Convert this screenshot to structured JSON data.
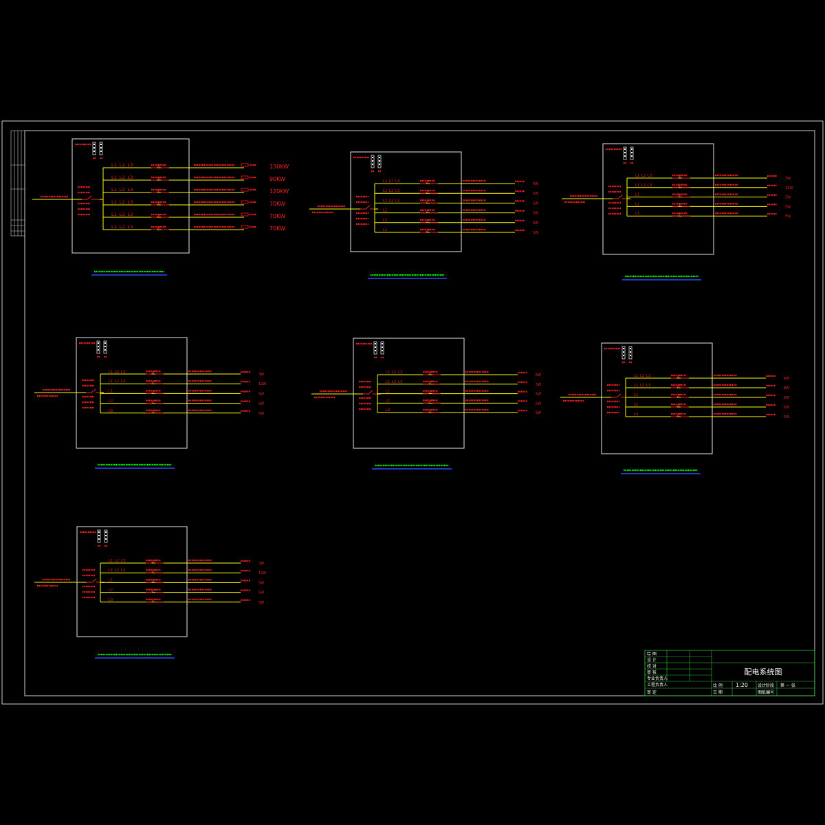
{
  "colors": {
    "background": "#000000",
    "frame": "#d0d0d0",
    "box": "#e8e8e8",
    "red": "#ff2020",
    "yellow": "#ffff00",
    "green": "#00ff00",
    "blue": "#2a4cff",
    "tb_green": "#33cc33"
  },
  "panel_top": {
    "loads": [
      "130KW",
      "90KW",
      "120KW",
      "70KW",
      "70KW",
      "70KW"
    ],
    "phases": [
      "L1 L2 L3",
      "L1 L2 L3",
      "L1 L2 L3",
      "L1 L2 L3",
      "L1 L2 L3",
      "L1 L2 L3"
    ]
  },
  "panel_c1": {
    "phases": [
      "L1 L2 L3",
      "L1 L2 L3",
      "L1 L2 L3",
      "L2",
      "L3",
      "L1"
    ],
    "kw": [
      "5W",
      "5W",
      "5W",
      "5W",
      "5W",
      "5W"
    ]
  },
  "panel_r1": {
    "phases": [
      "L1 L2 L3",
      "L1 L2 L3",
      "L1",
      "L2",
      "L3"
    ],
    "kw": [
      "3W",
      "15W",
      "5W",
      "5W",
      "5W"
    ]
  },
  "panel_l2": {
    "phases": [
      "L1 L2 L3",
      "L1 L2 L3",
      "L1",
      "L2",
      "L3"
    ],
    "kw": [
      "3W",
      "10W",
      "5W",
      "5W",
      "5W"
    ]
  },
  "panel_c2": {
    "phases": [
      "L1 L2 L3",
      "L1 L2 L3",
      "L1",
      "L2",
      "L3"
    ],
    "kw": [
      "6W",
      "5W",
      "5W",
      "5W",
      "5W"
    ]
  },
  "panel_r2": {
    "phases": [
      "L1 L2 L3",
      "L1 L2 L3",
      "L1",
      "L2",
      "L3"
    ],
    "kw": [
      "6W",
      "8W",
      "5W",
      "5W",
      "5W"
    ]
  },
  "panel_l3": {
    "phases": [
      "L1 L2 L3",
      "L1 L2 L3",
      "L1",
      "L2",
      "L3"
    ],
    "kw": [
      "3W",
      "10W",
      "5W",
      "5W",
      "5W"
    ]
  },
  "title_block": {
    "drawing_title": "配电系统图",
    "scale_label": "比 例",
    "scale_value": "1:20",
    "date_label": "日 期",
    "design_stage_label": "设计阶段",
    "sheet_label": "第 一 张",
    "drawing_no_label": "图纸编号",
    "rows": [
      "绘 图",
      "设 计",
      "校 对",
      "审 核",
      "专业负责人",
      "工程负责人",
      "审 定"
    ]
  }
}
